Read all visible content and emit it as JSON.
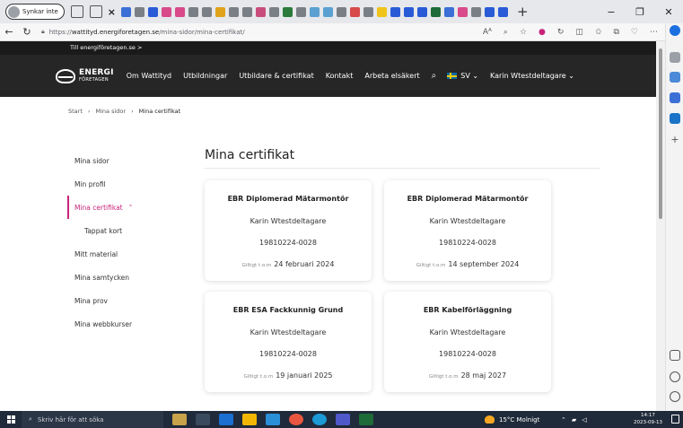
{
  "browser": {
    "profile_label": "Synkar inte",
    "url_prefix": "https://",
    "url_domain": "wattityd.energiforetagen.se",
    "url_path": "/mina-sidor/mina-certifikat/",
    "read_aloud": "Aᴬ",
    "close_tab_glyph": "×",
    "new_tab_glyph": "+",
    "minimize_glyph": "−",
    "restore_glyph": "❐",
    "close_glyph": "✕"
  },
  "site": {
    "top_link": "Till energiföretagen.se >",
    "logo_line1": "ENERGI",
    "logo_line2": "FÖRETAGEN",
    "nav": [
      "Om Wattityd",
      "Utbildningar",
      "Utbildare & certifikat",
      "Kontakt",
      "Arbeta elsäkert"
    ],
    "language": "SV",
    "user_name": "Karin Wtestdeltagare"
  },
  "breadcrumb": [
    "Start",
    "Mina sidor",
    "Mina certifikat"
  ],
  "breadcrumb_sep": "›",
  "sidemenu": [
    {
      "label": "Mina sidor"
    },
    {
      "label": "Min profil"
    },
    {
      "label": "Mina certifikat",
      "active": true
    },
    {
      "label": "Tappat kort",
      "sub": true
    },
    {
      "label": "Mitt material"
    },
    {
      "label": "Mina samtycken"
    },
    {
      "label": "Mina prov"
    },
    {
      "label": "Mina webbkurser"
    }
  ],
  "page_title": "Mina certifikat",
  "valid_label": "Giltigt t.o.m",
  "certificates": [
    {
      "title": "EBR Diplomerad Mätarmontör",
      "holder": "Karin Wtestdeltagare",
      "id": "19810224-0028",
      "valid_to": "24 februari 2024"
    },
    {
      "title": "EBR Diplomerad Mätarmontör",
      "holder": "Karin Wtestdeltagare",
      "id": "19810224-0028",
      "valid_to": "14 september 2024"
    },
    {
      "title": "EBR ESA Fackkunnig Grund",
      "holder": "Karin Wtestdeltagare",
      "id": "19810224-0028",
      "valid_to": "19 januari 2025"
    },
    {
      "title": "EBR Kabelförläggning",
      "holder": "Karin Wtestdeltagare",
      "id": "19810224-0028",
      "valid_to": "28 maj 2027"
    }
  ],
  "taskbar": {
    "search_placeholder": "Skriv här för att söka",
    "weather": "15°C Molnigt",
    "time": "14:17",
    "date": "2023-09-13"
  },
  "colors": {
    "accent": "#c7247a",
    "nav_bg": "#262626",
    "topbar_bg": "#1a1a1a"
  }
}
